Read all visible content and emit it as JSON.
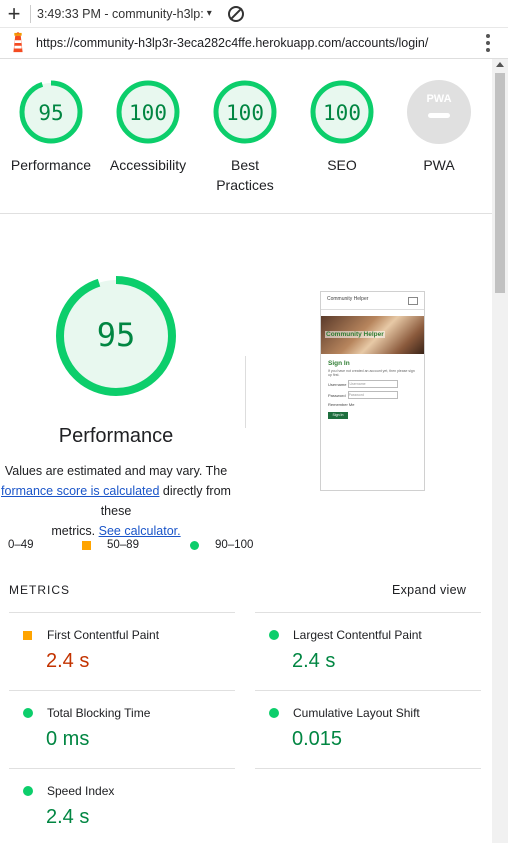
{
  "topbar": {
    "plus": "+",
    "tab_title": "3:49:33 PM - community-h3lp:",
    "dropdown": "▾"
  },
  "urlbar": {
    "url": "https://community-h3lp3r-3eca282c4ffe.herokuapp.com/accounts/login/"
  },
  "gauges": [
    {
      "score": "95",
      "label": "Performance",
      "fraction": 0.95
    },
    {
      "score": "100",
      "label": "Accessibility",
      "fraction": 1.0
    },
    {
      "score": "100",
      "label_line1": "Best",
      "label_line2": "Practices",
      "fraction": 1.0
    },
    {
      "score": "100",
      "label": "SEO",
      "fraction": 1.0
    },
    {
      "score": "",
      "badge": "PWA",
      "label": "PWA"
    }
  ],
  "performance": {
    "score": "95",
    "title": "Performance",
    "note_line1": "Values are estimated and may vary. The",
    "note_link": "formance score is calculated",
    "note_after_link": " directly from these",
    "note_line3_pre": "metrics. ",
    "calc_link": "See calculator."
  },
  "screenshot": {
    "site_name": "Community Helper",
    "hero_text": "Community Helper",
    "sign_in": "Sign In",
    "intro": "If you have not created an account yet, then please sign up first.",
    "username_label": "Username",
    "username_placeholder": "Username",
    "password_label": "Password",
    "password_placeholder": "Password",
    "remember": "Remember Me",
    "button": "Sign In"
  },
  "legend": {
    "fail": "0–49",
    "average": "50–89",
    "pass": "90–100"
  },
  "metrics": {
    "heading": "METRICS",
    "expand": "Expand view",
    "items": [
      {
        "name": "First Contentful Paint",
        "value": "2.4 s",
        "status": "average"
      },
      {
        "name": "Largest Contentful Paint",
        "value": "2.4 s",
        "status": "pass"
      },
      {
        "name": "Total Blocking Time",
        "value": "0 ms",
        "status": "pass"
      },
      {
        "name": "Cumulative Layout Shift",
        "value": "0.015",
        "status": "pass"
      },
      {
        "name": "Speed Index",
        "value": "2.4 s",
        "status": "pass"
      }
    ]
  },
  "colors": {
    "pass": "#0cce6b",
    "pass_text": "#018642",
    "average": "#ffa400",
    "average_text": "#c33300",
    "fail": "#cc0000"
  }
}
